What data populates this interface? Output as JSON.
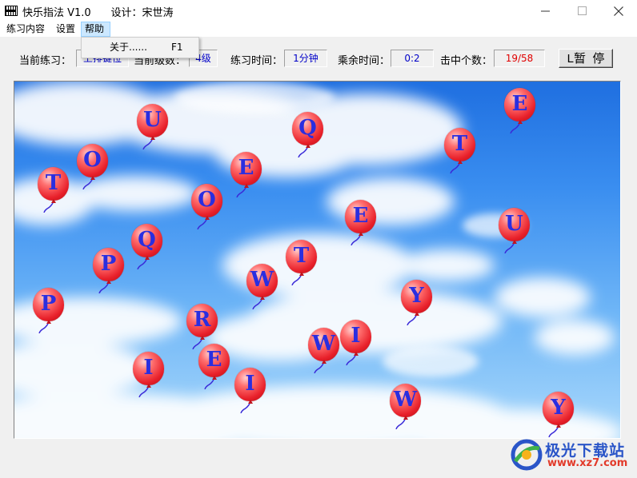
{
  "window": {
    "title": "快乐指法 V1.0",
    "designer_label": "设计：宋世涛"
  },
  "menubar": {
    "items": [
      {
        "label": "练习内容"
      },
      {
        "label": "设置"
      },
      {
        "label": "帮助",
        "active": true
      }
    ]
  },
  "help_menu": {
    "about_label": "关于......",
    "about_shortcut": "F1"
  },
  "status": {
    "current_practice_label": "当前练习：",
    "current_practice_value": "上排键位",
    "current_level_label": "当前级数：",
    "current_level_value": "4级",
    "practice_time_label": "练习时间：",
    "practice_time_value": "1分钟",
    "remaining_time_label": "乘余时间：",
    "remaining_time_value": "0:2",
    "hit_count_label": "击中个数：",
    "hit_count_value": "19/58",
    "pause_button_label": "L暂  停"
  },
  "colors": {
    "sky_top": "#1f6fe0",
    "balloon": "#e8202a",
    "letter": "#2a2ee0",
    "counter_text": "#e00000",
    "field_text": "#0000c8"
  },
  "balloons": [
    "U",
    "Q",
    "E",
    "O",
    "T",
    "E",
    "T",
    "O",
    "E",
    "U",
    "Q",
    "P",
    "T",
    "W",
    "Y",
    "P",
    "R",
    "W",
    "I",
    "E",
    "I",
    "I",
    "W",
    "Y"
  ],
  "watermark": {
    "text": "极光下载站",
    "url": "www.xz7.com"
  }
}
